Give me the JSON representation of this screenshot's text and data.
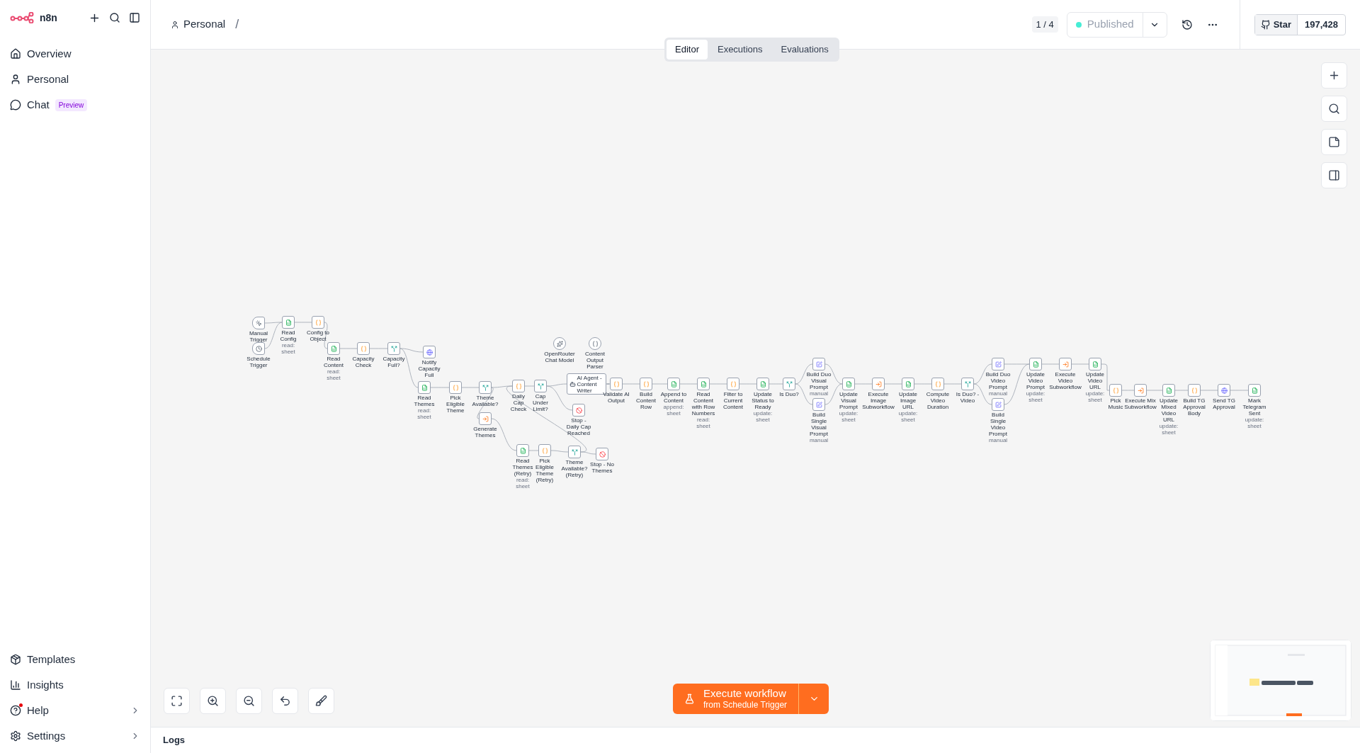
{
  "sidebar": {
    "brand": "n8n",
    "items": [
      {
        "label": "Overview",
        "selected": false
      },
      {
        "label": "Personal",
        "selected": false
      },
      {
        "label": "Chat",
        "selected": false,
        "badge": "Preview"
      }
    ],
    "bottom_items": [
      {
        "label": "Templates",
        "notification": false
      },
      {
        "label": "Insights",
        "notification": false
      },
      {
        "label": "Help",
        "notification": true
      },
      {
        "label": "Settings",
        "notification": false
      }
    ]
  },
  "header": {
    "breadcrumb": "Personal",
    "separator": "/",
    "version_counter": "1 / 4",
    "publish": {
      "label": "Published",
      "disabled": true
    },
    "github": {
      "label": "Star",
      "count": "197,428"
    }
  },
  "tabs": [
    {
      "label": "Editor",
      "selected": true
    },
    {
      "label": "Executions",
      "selected": false
    },
    {
      "label": "Evaluations",
      "selected": false
    }
  ],
  "nodes": [
    {
      "label": "Manual Trigger",
      "kind": "manual"
    },
    {
      "label": "Schedule Trigger",
      "kind": "schedule"
    },
    {
      "label": "Read Config",
      "subtitle": "read: sheet",
      "kind": "sheets"
    },
    {
      "label": "Config to Object",
      "kind": "code"
    },
    {
      "label": "Read Content",
      "subtitle": "read: sheet",
      "kind": "sheets"
    },
    {
      "label": "Capacity Check",
      "kind": "code"
    },
    {
      "label": "Capacity Full?",
      "kind": "if"
    },
    {
      "label": "Notify Capacity Full",
      "kind": "http"
    },
    {
      "label": "Read Themes",
      "subtitle": "read: sheet",
      "kind": "sheets"
    },
    {
      "label": "Pick Eligible Theme",
      "kind": "code"
    },
    {
      "label": "Theme Available?",
      "kind": "if"
    },
    {
      "label": "Generate Themes",
      "kind": "subworkflow"
    },
    {
      "label": "Daily Cap Check",
      "kind": "code"
    },
    {
      "label": "Cap Under Limit?",
      "kind": "if"
    },
    {
      "label": "OpenRouter Chat Model",
      "kind": "model"
    },
    {
      "label": "Content Output Parser",
      "kind": "parser"
    },
    {
      "label": "AI Agent - Content Writer",
      "kind": "agent"
    },
    {
      "label": "Stop - Daily Cap Reached",
      "kind": "stop"
    },
    {
      "label": "Read Themes (Retry)",
      "subtitle": "read: sheet",
      "kind": "sheets"
    },
    {
      "label": "Pick Eligible Theme (Retry)",
      "kind": "code"
    },
    {
      "label": "Theme Available? (Retry)",
      "kind": "if"
    },
    {
      "label": "Stop - No Themes",
      "kind": "stop"
    },
    {
      "label": "Validate AI Output",
      "kind": "code"
    },
    {
      "label": "Build Content Row",
      "kind": "code"
    },
    {
      "label": "Append to Content",
      "subtitle": "append: sheet",
      "kind": "sheets"
    },
    {
      "label": "Read Content with Row Numbers",
      "subtitle": "read: sheet",
      "kind": "sheets"
    },
    {
      "label": "Filter to Current Content",
      "kind": "code"
    },
    {
      "label": "Update Status to Ready",
      "subtitle": "update: sheet",
      "kind": "sheets"
    },
    {
      "label": "Is Duo?",
      "kind": "if"
    },
    {
      "label": "Build Duo Visual Prompt",
      "subtitle": "manual",
      "kind": "edit"
    },
    {
      "label": "Build Single Visual Prompt",
      "subtitle": "manual",
      "kind": "edit"
    },
    {
      "label": "Update Visual Prompt",
      "subtitle": "update: sheet",
      "kind": "sheets"
    },
    {
      "label": "Execute Image Subworkflow",
      "kind": "subworkflow"
    },
    {
      "label": "Update Image URL",
      "subtitle": "update: sheet",
      "kind": "sheets"
    },
    {
      "label": "Compute Video Duration",
      "kind": "code"
    },
    {
      "label": "Is Duo? - Video",
      "kind": "if"
    },
    {
      "label": "Build Duo Video Prompt",
      "subtitle": "manual",
      "kind": "edit"
    },
    {
      "label": "Build Single Video Prompt",
      "subtitle": "manual",
      "kind": "edit"
    },
    {
      "label": "Update Video Prompt",
      "subtitle": "update: sheet",
      "kind": "sheets"
    },
    {
      "label": "Execute Video Subworkflow",
      "kind": "subworkflow"
    },
    {
      "label": "Update Video URL",
      "subtitle": "update: sheet",
      "kind": "sheets"
    },
    {
      "label": "Pick Music",
      "kind": "code"
    },
    {
      "label": "Execute Mix Subworkflow",
      "kind": "subworkflow"
    },
    {
      "label": "Update Mixed Video URL",
      "subtitle": "update: sheet",
      "kind": "sheets"
    },
    {
      "label": "Build TG Approval Body",
      "kind": "code"
    },
    {
      "label": "Send TG Approval",
      "kind": "http"
    },
    {
      "label": "Mark Telegram Sent",
      "subtitle": "update: sheet",
      "kind": "sheets"
    }
  ],
  "execute_button": {
    "label": "Execute workflow",
    "sublabel": "from Schedule Trigger"
  },
  "logs": {
    "label": "Logs"
  }
}
